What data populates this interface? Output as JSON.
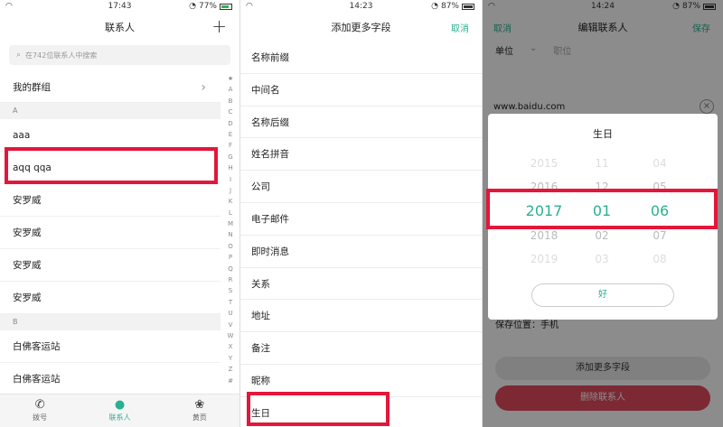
{
  "panel1": {
    "status": {
      "time": "17:43",
      "battery": "77%"
    },
    "title": "联系人",
    "search_placeholder": "在742位联系人中搜索",
    "group_label": "我的群组",
    "sections": [
      {
        "letter": "A",
        "rows": [
          "aaa",
          "aqq qqa",
          "安罗威",
          "安罗威",
          "安罗威",
          "安罗威"
        ]
      },
      {
        "letter": "B",
        "rows": [
          "白佛客运站",
          "白佛客运站"
        ]
      }
    ],
    "alpha_index": [
      "★",
      "A",
      "B",
      "C",
      "D",
      "E",
      "F",
      "G",
      "H",
      "I",
      "J",
      "K",
      "L",
      "M",
      "N",
      "O",
      "P",
      "Q",
      "R",
      "S",
      "T",
      "U",
      "V",
      "W",
      "X",
      "Y",
      "Z",
      "#"
    ],
    "tabs": [
      {
        "label": "拨号",
        "icon": "phone-icon"
      },
      {
        "label": "联系人",
        "icon": "person-icon"
      },
      {
        "label": "黄页",
        "icon": "clover-icon"
      }
    ]
  },
  "panel2": {
    "status": {
      "time": "14:23",
      "battery": "87%"
    },
    "title": "添加更多字段",
    "cancel_label": "取消",
    "fields": [
      "名称前缀",
      "中间名",
      "名称后缀",
      "姓名拼音",
      "公司",
      "电子邮件",
      "即时消息",
      "关系",
      "地址",
      "备注",
      "昵称",
      "生日"
    ]
  },
  "panel3": {
    "status": {
      "time": "14:24",
      "battery": "87%"
    },
    "title": "编辑联系人",
    "cancel_label": "取消",
    "save_label": "保存",
    "company_label": "单位",
    "position_placeholder": "职位",
    "website": "www.baidu.com",
    "save_location": "保存位置：手机",
    "add_more_label": "添加更多字段",
    "delete_label": "删除联系人",
    "picker": {
      "title": "生日",
      "years": [
        "2015",
        "2016",
        "2017",
        "2018",
        "2019"
      ],
      "months": [
        "11",
        "12",
        "01",
        "02",
        "03"
      ],
      "days": [
        "04",
        "05",
        "06",
        "07",
        "08"
      ],
      "ok_label": "好"
    }
  },
  "colors": {
    "accent": "#2ab090",
    "highlight": "#e3163b",
    "delete": "#e24b5f"
  }
}
